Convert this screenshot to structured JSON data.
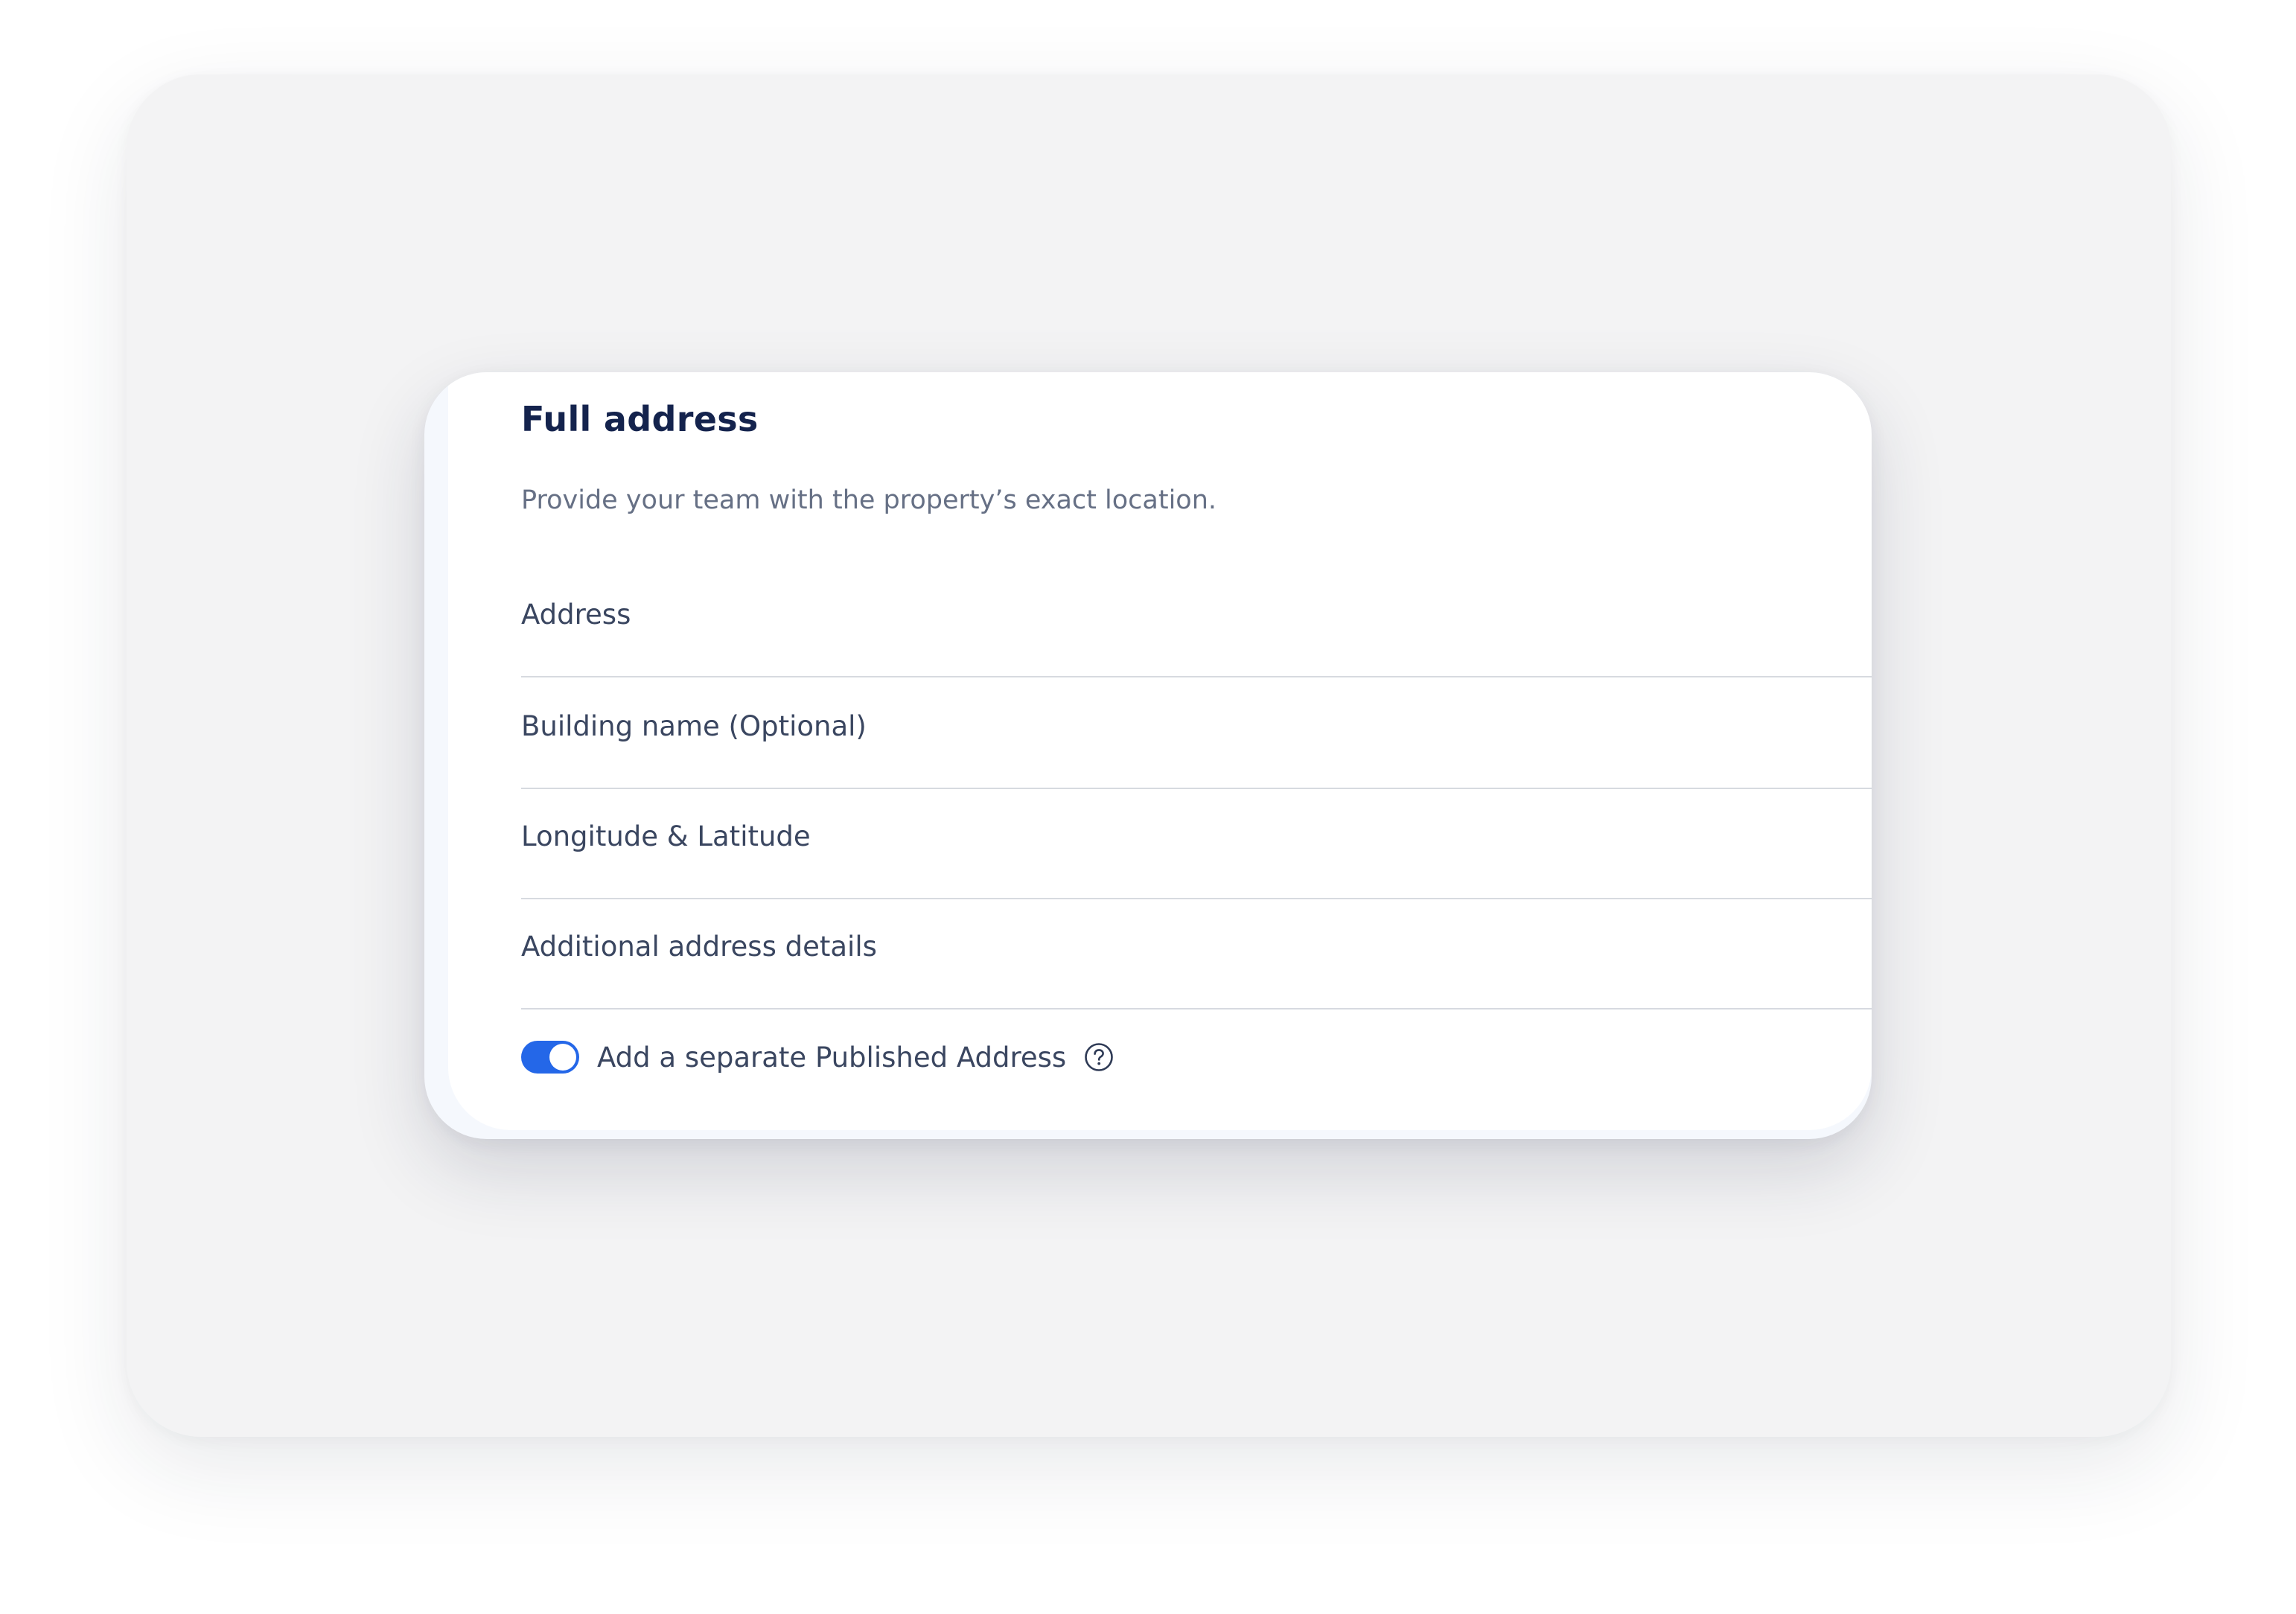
{
  "card": {
    "title": "Full address",
    "subtitle": "Provide your team with the property’s exact location."
  },
  "fields": [
    {
      "label": "Address"
    },
    {
      "label": "Building name (Optional)"
    },
    {
      "label": "Longitude & Latitude"
    },
    {
      "label": "Additional address details"
    }
  ],
  "published_address_toggle": {
    "label": "Add a separate Published Address",
    "on": true,
    "help_icon": "question-circle-icon"
  },
  "colors": {
    "accent": "#2467e8",
    "title": "#14234d",
    "text": "#3a4660",
    "muted": "#667085",
    "divider": "#d7dae0",
    "backdrop": "#f3f3f4"
  }
}
